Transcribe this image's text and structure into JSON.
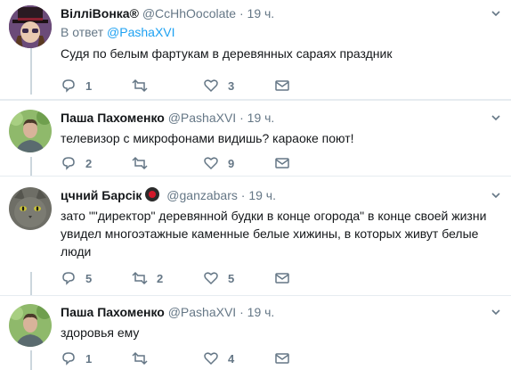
{
  "tweets": [
    {
      "name": "ВіллiВонка",
      "verified_mark": "®",
      "handle": "@CcHhOocolate",
      "dot": "·",
      "time": "19 ч.",
      "reply_prefix": "В ответ",
      "reply_to": "@PashaXVI",
      "text": "Судя по белым фартукам в деревянных сараях праздник",
      "replies": "1",
      "retweets": "",
      "likes": "3"
    },
    {
      "name": "Паша Пахоменко",
      "handle": "@PashaXVI",
      "dot": "·",
      "time": "19 ч.",
      "text": "телевизор с микрофонами видишь? караоке поют!",
      "replies": "2",
      "retweets": "",
      "likes": "9"
    },
    {
      "name": "цчний Барсiк",
      "handle": "@ganzabars",
      "dot": "·",
      "time": "19 ч.",
      "text": "зато \"\"директор\" деревянной будки в конце огорода\" в конце своей жизни увидел многоэтажные каменные белые  хижины, в которых живут белые люди",
      "replies": "5",
      "retweets": "2",
      "likes": "5"
    },
    {
      "name": "Паша Пахоменко",
      "handle": "@PashaXVI",
      "dot": "·",
      "time": "19 ч.",
      "text": "здоровья ему",
      "replies": "1",
      "retweets": "",
      "likes": "4"
    }
  ],
  "colors": {
    "text": "#14171a",
    "muted": "#657786",
    "link": "#1da1f2",
    "divider": "#e6ecf0"
  },
  "icons": {
    "reply": "reply-icon",
    "retweet": "retweet-icon",
    "like": "heart-icon",
    "message": "envelope-icon",
    "more": "chevron-down-icon"
  }
}
